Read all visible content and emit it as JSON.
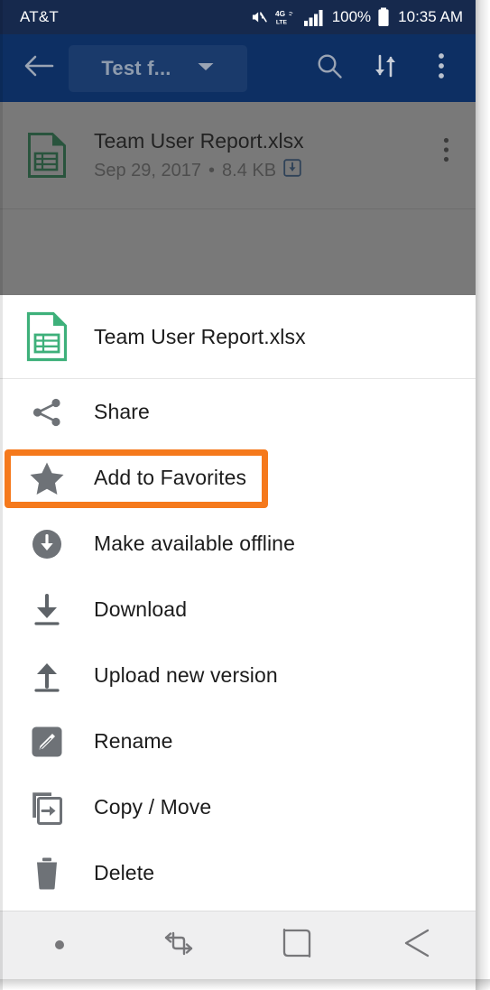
{
  "status_bar": {
    "carrier": "AT&T",
    "mute_icon": "mute-icon",
    "network_icon": "4g-lte-icon",
    "signal_icon": "signal-bars-icon",
    "battery_percent": "100%",
    "battery_icon": "battery-full-icon",
    "clock": "10:35 AM",
    "background_color": "#16294d",
    "text_color": "#ffffff"
  },
  "toolbar": {
    "back_icon": "back-arrow-icon",
    "folder_chip_label": "Test f...",
    "folder_chip_caret_icon": "chevron-down-icon",
    "search_icon": "search-icon",
    "sort_icon": "sort-icon",
    "overflow_icon": "more-vertical-icon",
    "background_color": "#0d2f63"
  },
  "file_list": {
    "rows": [
      {
        "icon": "spreadsheet-file-icon",
        "name": "Team User Report.xlsx",
        "date": "Sep 29, 2017",
        "separator": "•",
        "size": "8.4 KB",
        "offline_badge_icon": "offline-available-icon",
        "more_icon": "more-vertical-icon"
      }
    ]
  },
  "sheet": {
    "header": {
      "icon": "spreadsheet-file-icon",
      "title": "Team User Report.xlsx"
    },
    "items": [
      {
        "icon": "share-icon",
        "label": "Share"
      },
      {
        "icon": "star-icon",
        "label": "Add to Favorites"
      },
      {
        "icon": "offline-circle-icon",
        "label": "Make available offline"
      },
      {
        "icon": "download-icon",
        "label": "Download"
      },
      {
        "icon": "upload-icon",
        "label": "Upload new version"
      },
      {
        "icon": "rename-pencil-icon",
        "label": "Rename"
      },
      {
        "icon": "copy-move-icon",
        "label": "Copy / Move"
      },
      {
        "icon": "trash-icon",
        "label": "Delete"
      }
    ]
  },
  "highlight": {
    "target_label": "Add to Favorites",
    "color": "#f5791c"
  },
  "nav_bar": {
    "items": [
      {
        "icon": "dot-icon",
        "label": ""
      },
      {
        "icon": "recents-icon",
        "label": ""
      },
      {
        "icon": "home-icon",
        "label": ""
      },
      {
        "icon": "back-icon",
        "label": ""
      }
    ],
    "background_color": "#efeff0"
  }
}
